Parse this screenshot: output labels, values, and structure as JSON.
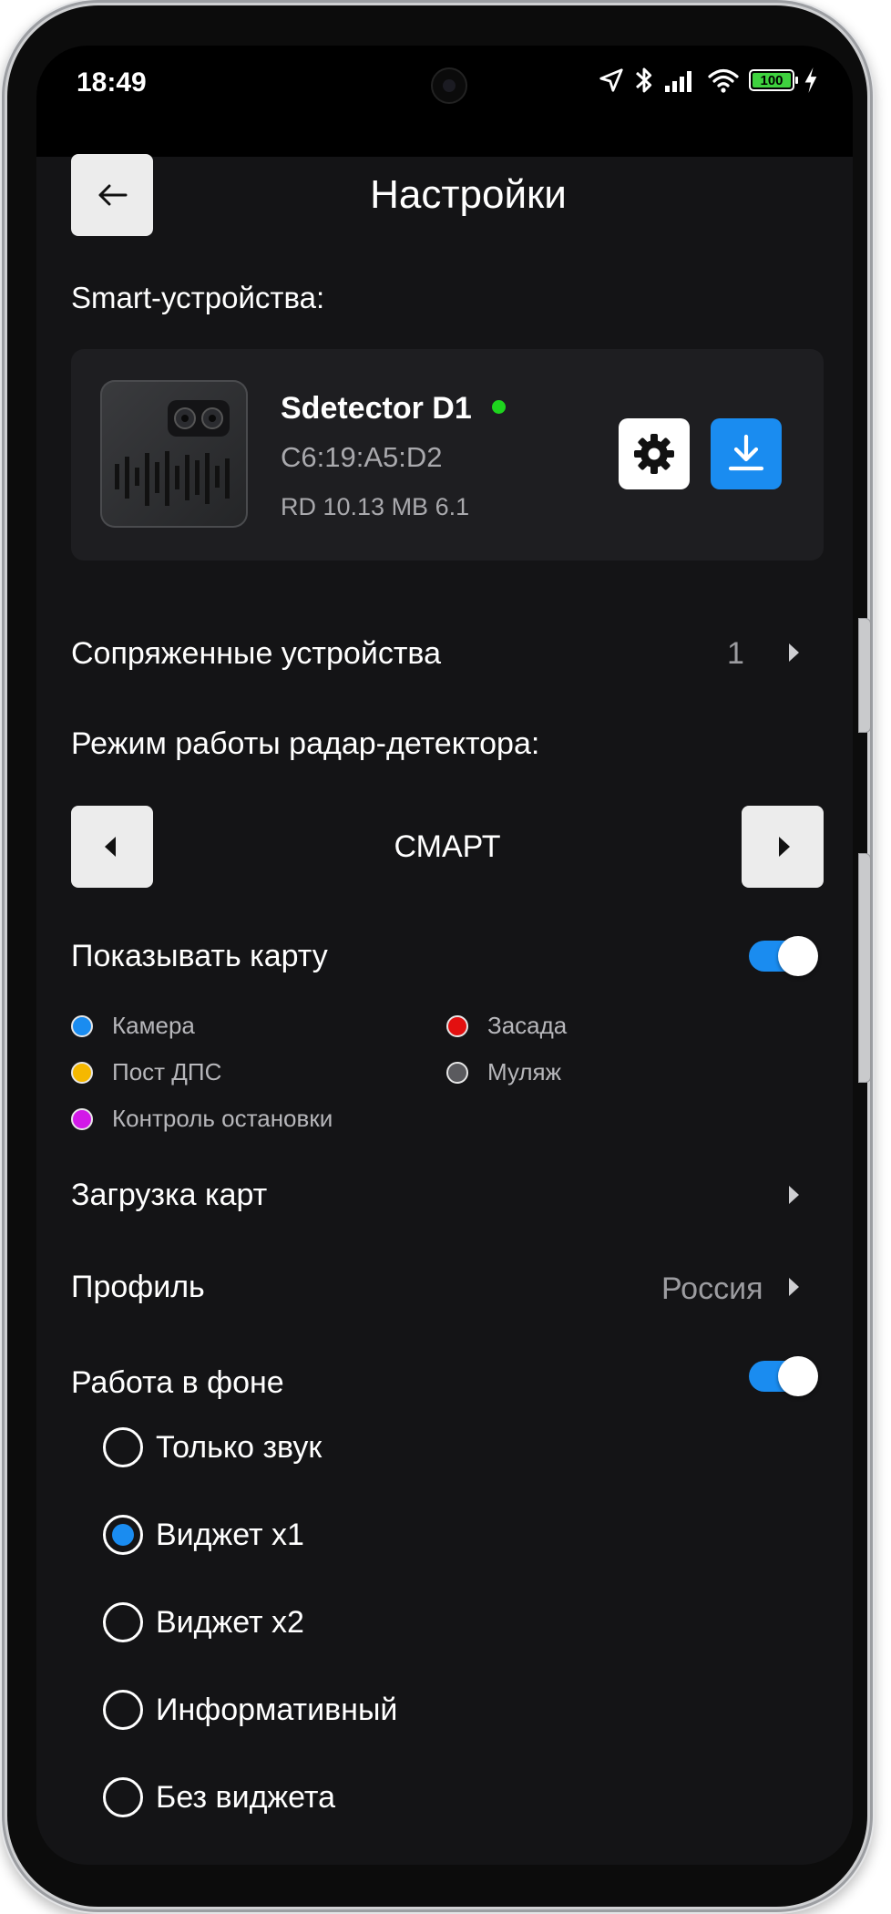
{
  "status_bar": {
    "time": "18:49",
    "battery_level": "100"
  },
  "header": {
    "title": "Настройки",
    "back_icon": "arrow-left-icon"
  },
  "smart_devices": {
    "section_label": "Smart-устройства:",
    "device": {
      "name": "Sdetector D1",
      "mac": "C6:19:A5:D2",
      "version": "RD 10.13 MB 6.1",
      "online": true,
      "online_color": "#1ed51e"
    }
  },
  "paired_devices": {
    "label": "Сопряженные устройства",
    "count": "1"
  },
  "radar_mode": {
    "label": "Режим работы радар-детектора:",
    "value": "СМАРТ"
  },
  "show_map": {
    "label": "Показывать карту",
    "enabled": true,
    "legend": [
      {
        "label": "Камера",
        "color": "#1a8cf0"
      },
      {
        "label": "Засада",
        "color": "#e31010"
      },
      {
        "label": "Пост ДПС",
        "color": "#f5b800"
      },
      {
        "label": "Муляж",
        "color": "#5a5a5e"
      },
      {
        "label": "Контроль остановки",
        "color": "#d21ae8"
      }
    ]
  },
  "map_download": {
    "label": "Загрузка карт"
  },
  "profile": {
    "label": "Профиль",
    "value": "Россия"
  },
  "background": {
    "label": "Работа в фоне",
    "enabled": true,
    "options": [
      {
        "label": "Только звук",
        "selected": false
      },
      {
        "label": "Виджет x1",
        "selected": true
      },
      {
        "label": "Виджет x2",
        "selected": false
      },
      {
        "label": "Информативный",
        "selected": false
      },
      {
        "label": "Без виджета",
        "selected": false
      }
    ]
  },
  "colors": {
    "accent": "#1a8cf0",
    "background": "#141416",
    "card": "#1e1e21"
  }
}
